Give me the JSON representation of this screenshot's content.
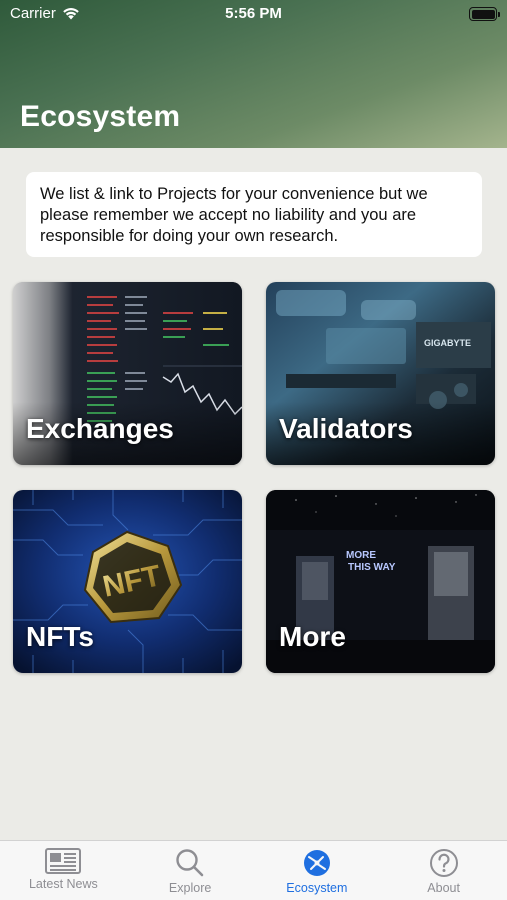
{
  "status_bar": {
    "carrier": "Carrier",
    "time": "5:56 PM"
  },
  "header": {
    "title": "Ecosystem"
  },
  "disclaimer": {
    "text": "We list & link to Projects for your convenience but we please remember we accept no liability and you are responsible for doing your own research."
  },
  "cards": [
    {
      "label": "Exchanges"
    },
    {
      "label": "Validators"
    },
    {
      "label": "NFTs"
    },
    {
      "label": "More"
    }
  ],
  "card_art": {
    "validators_sign": "GIGABYTE",
    "nft_badge": "NFT",
    "neon_line1": "MORE",
    "neon_line2": "THIS WAY"
  },
  "tabbar": {
    "active": "Ecosystem",
    "accent_color": "#1f6fe0",
    "tabs": [
      {
        "label": "Latest News",
        "icon": "newspaper-icon"
      },
      {
        "label": "Explore",
        "icon": "magnifier-icon"
      },
      {
        "label": "Ecosystem",
        "icon": "globe-icon"
      },
      {
        "label": "About",
        "icon": "question-circle-icon"
      }
    ]
  }
}
